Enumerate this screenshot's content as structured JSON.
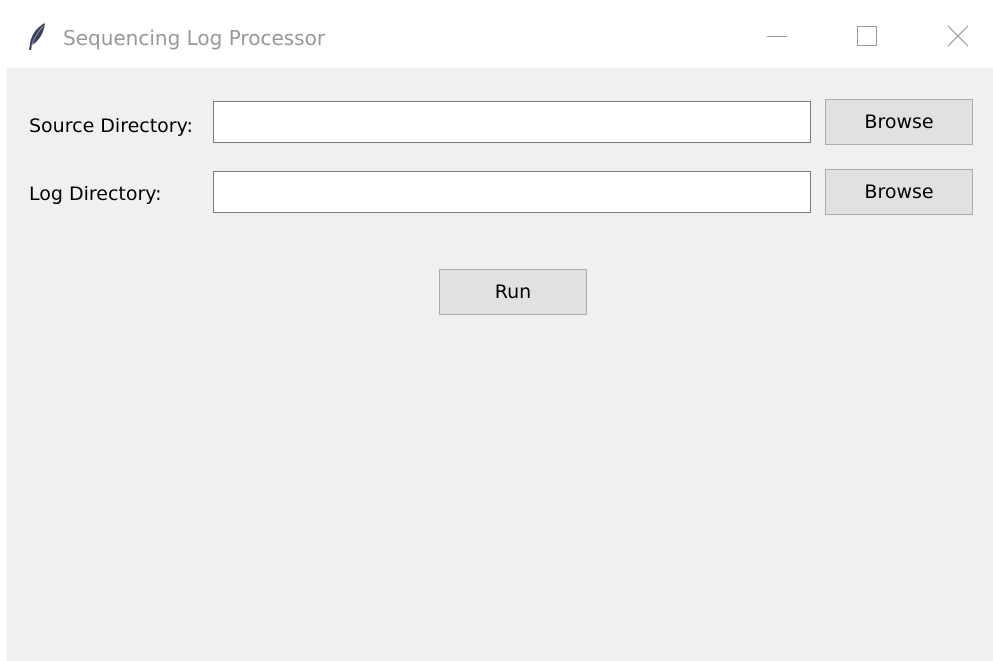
{
  "window": {
    "title": "Sequencing Log Processor",
    "app_icon": "feather-icon",
    "controls": {
      "minimize_icon": "minimize-icon",
      "maximize_icon": "maximize-icon",
      "close_icon": "close-icon"
    }
  },
  "form": {
    "source": {
      "label": "Source Directory:",
      "value": "",
      "browse_label": "Browse"
    },
    "log": {
      "label": "Log Directory:",
      "value": "",
      "browse_label": "Browse"
    },
    "run_label": "Run"
  },
  "colors": {
    "client_background": "#f0f0f0",
    "button_background": "#e1e1e1",
    "button_border": "#adadad",
    "entry_border": "#7a7a7a",
    "title_text": "#999999"
  }
}
